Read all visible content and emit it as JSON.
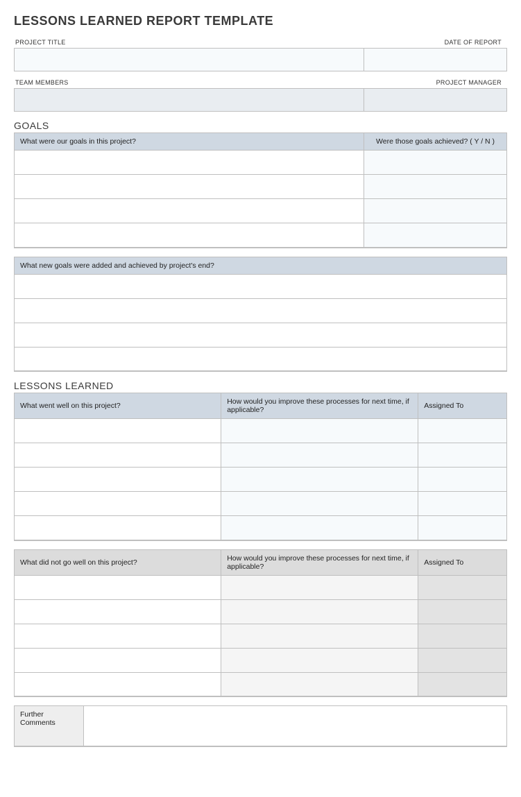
{
  "title": "LESSONS LEARNED REPORT TEMPLATE",
  "header_fields": {
    "project_title_label": "PROJECT TITLE",
    "date_of_report_label": "DATE OF REPORT",
    "team_members_label": "TEAM MEMBERS",
    "project_manager_label": "PROJECT MANAGER",
    "project_title_value": "",
    "date_of_report_value": "",
    "team_members_value": "",
    "project_manager_value": ""
  },
  "goals": {
    "heading": "GOALS",
    "table1": {
      "col1": "What were our goals in this project?",
      "col2": "Were those goals achieved?  ( Y / N )",
      "rows": [
        {
          "goal": "",
          "achieved": ""
        },
        {
          "goal": "",
          "achieved": ""
        },
        {
          "goal": "",
          "achieved": ""
        },
        {
          "goal": "",
          "achieved": ""
        }
      ]
    },
    "table2": {
      "col1": "What new goals were added and achieved by project's end?",
      "rows": [
        {
          "goal": ""
        },
        {
          "goal": ""
        },
        {
          "goal": ""
        },
        {
          "goal": ""
        }
      ]
    }
  },
  "lessons": {
    "heading": "LESSONS LEARNED",
    "table1": {
      "col1": "What went well on this project?",
      "col2": "How would you improve these processes for next time, if applicable?",
      "col3": "Assigned To",
      "rows": [
        {
          "well": "",
          "improve": "",
          "assigned": ""
        },
        {
          "well": "",
          "improve": "",
          "assigned": ""
        },
        {
          "well": "",
          "improve": "",
          "assigned": ""
        },
        {
          "well": "",
          "improve": "",
          "assigned": ""
        },
        {
          "well": "",
          "improve": "",
          "assigned": ""
        }
      ]
    },
    "table2": {
      "col1": "What did not go well on this project?",
      "col2": "How would you improve these processes for next time, if applicable?",
      "col3": "Assigned To",
      "rows": [
        {
          "bad": "",
          "improve": "",
          "assigned": ""
        },
        {
          "bad": "",
          "improve": "",
          "assigned": ""
        },
        {
          "bad": "",
          "improve": "",
          "assigned": ""
        },
        {
          "bad": "",
          "improve": "",
          "assigned": ""
        },
        {
          "bad": "",
          "improve": "",
          "assigned": ""
        }
      ]
    }
  },
  "comments": {
    "label": "Further Comments",
    "value": ""
  }
}
